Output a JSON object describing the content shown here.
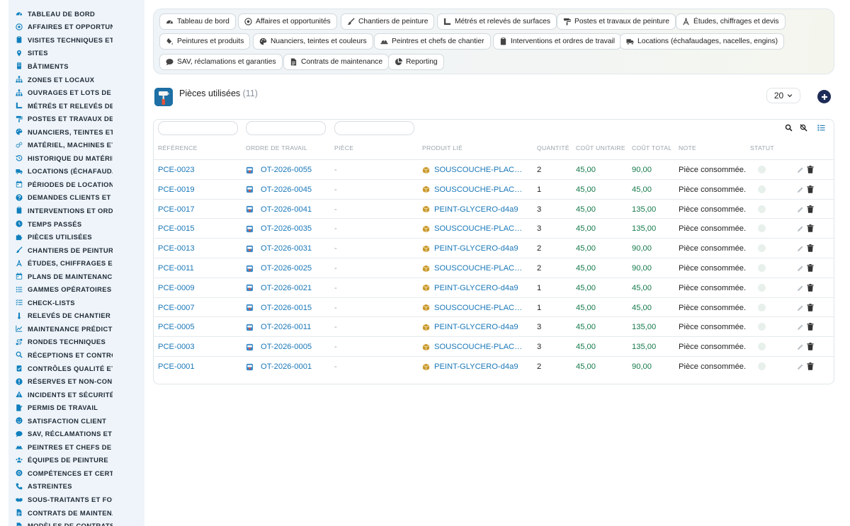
{
  "sidebar": {
    "items": [
      {
        "label": "TABLEAU DE BORD",
        "icon": "dashboard-icon"
      },
      {
        "label": "AFFAIRES ET OPPORTUNITÉS",
        "icon": "target-icon"
      },
      {
        "label": "VISITES TECHNIQUES ET DIAGNOSTICS",
        "icon": "clipboard-icon"
      },
      {
        "label": "SITES",
        "icon": "map-pin-icon"
      },
      {
        "label": "BÂTIMENTS",
        "icon": "building-icon"
      },
      {
        "label": "ZONES ET LOCAUX",
        "icon": "hierarchy-icon"
      },
      {
        "label": "OUVRAGES ET LOTS DE TRAVAUX",
        "icon": "hierarchy-icon"
      },
      {
        "label": "MÉTRÉS ET RELEVÉS DE SURFACES",
        "icon": "ruler-icon"
      },
      {
        "label": "POSTES ET TRAVAUX DE PEINTURE",
        "icon": "paint-roller-icon"
      },
      {
        "label": "NUANCIERS, TEINTES ET COULEURS",
        "icon": "palette-icon"
      },
      {
        "label": "MATÉRIEL, MACHINES ET OUTILLAGE",
        "icon": "gears-icon"
      },
      {
        "label": "HISTORIQUE DU MATÉRIEL",
        "icon": "history-icon"
      },
      {
        "label": "LOCATIONS (ÉCHAFAUDAGES, NACELLES)",
        "icon": "truck-icon"
      },
      {
        "label": "PÉRIODES DE LOCATION",
        "icon": "calendar-icon"
      },
      {
        "label": "DEMANDES CLIENTS ET INTERVENTIONS",
        "icon": "question-icon"
      },
      {
        "label": "INTERVENTIONS ET ORDRES DE TRAVAIL",
        "icon": "clipboard-icon"
      },
      {
        "label": "TEMPS PASSÉS",
        "icon": "clock-icon"
      },
      {
        "label": "PIÈCES UTILISÉES",
        "icon": "puzzle-icon"
      },
      {
        "label": "CHANTIERS DE PEINTURE",
        "icon": "brush-icon"
      },
      {
        "label": "ÉTUDES, CHIFFRAGES ET DEVIS",
        "icon": "compass-icon"
      },
      {
        "label": "PLANS DE MAINTENANCE",
        "icon": "calendar-icon"
      },
      {
        "label": "GAMMES OPÉRATOIRES",
        "icon": "list-icon"
      },
      {
        "label": "CHECK-LISTS",
        "icon": "checklist-icon"
      },
      {
        "label": "RELEVÉS DE CHANTIER",
        "icon": "thermometer-icon"
      },
      {
        "label": "MAINTENANCE PRÉDICTIVE",
        "icon": "chart-icon"
      },
      {
        "label": "RONDES TECHNIQUES",
        "icon": "route-icon"
      },
      {
        "label": "RÉCEPTIONS ET CONTRÔLES",
        "icon": "search-icon"
      },
      {
        "label": "CONTRÔLES QUALITÉ ET AUDITS",
        "icon": "clipboard-check-icon"
      },
      {
        "label": "RÉSERVES ET NON-CONFORMITÉS",
        "icon": "alert-circle-icon"
      },
      {
        "label": "INCIDENTS ET SÉCURITÉ",
        "icon": "warning-icon"
      },
      {
        "label": "PERMIS DE TRAVAIL",
        "icon": "file-signature-icon"
      },
      {
        "label": "SATISFACTION CLIENT",
        "icon": "smile-icon"
      },
      {
        "label": "SAV, RÉCLAMATIONS ET GARANTIES",
        "icon": "comment-icon"
      },
      {
        "label": "PEINTRES ET CHEFS DE CHANTIER",
        "icon": "hard-hat-icon"
      },
      {
        "label": "ÉQUIPES DE PEINTURE",
        "icon": "users-icon"
      },
      {
        "label": "COMPÉTENCES ET CERTIFICATIONS",
        "icon": "badge-icon"
      },
      {
        "label": "ASTREINTES",
        "icon": "phone-icon"
      },
      {
        "label": "SOUS-TRAITANTS ET FOURNISSEURS",
        "icon": "handshake-icon"
      },
      {
        "label": "CONTRATS DE MAINTENANCE",
        "icon": "file-icon"
      },
      {
        "label": "MODÈLES DE CONTRATS",
        "icon": "file-icon"
      }
    ]
  },
  "nav": {
    "chips": [
      {
        "label": "Tableau de bord",
        "icon": "dashboard-icon"
      },
      {
        "label": "Affaires et opportunités",
        "icon": "target-icon"
      },
      {
        "label": "Chantiers de peinture",
        "icon": "brush-icon"
      },
      {
        "label": "Métrés et relevés de surfaces",
        "icon": "ruler-icon"
      },
      {
        "label": "Postes et travaux de peinture",
        "icon": "paint-roller-icon"
      },
      {
        "label": "Études, chiffrages et devis",
        "icon": "compass-icon"
      },
      {
        "label": "Peintures et produits",
        "icon": "fill-drip-icon"
      },
      {
        "label": "Nuanciers, teintes et couleurs",
        "icon": "palette-icon"
      },
      {
        "label": "Peintres et chefs de chantier",
        "icon": "hard-hat-icon"
      },
      {
        "label": "Interventions et ordres de travail",
        "icon": "clipboard-icon"
      },
      {
        "label": "Locations (échafaudages, nacelles, engins)",
        "icon": "truck-icon"
      },
      {
        "label": "SAV, réclamations et garanties",
        "icon": "comment-icon"
      },
      {
        "label": "Contrats de maintenance",
        "icon": "file-icon"
      },
      {
        "label": "Reporting",
        "icon": "chart-pie-icon"
      }
    ]
  },
  "header": {
    "title": "Pièces utilisées",
    "count": "(11)",
    "page_size": "20"
  },
  "table": {
    "columns": [
      "RÉFÉRENCE",
      "ORDRE DE TRAVAIL",
      "PIÈCE",
      "PRODUIT LIÉ",
      "QUANTITÉ",
      "COÛT UNITAIRE",
      "COÛT TOTAL",
      "NOTE",
      "STATUT"
    ],
    "rows": [
      {
        "ref": "PCE-0023",
        "ordre": "OT-2026-0055",
        "piece": "-",
        "produit": "SOUSCOUCHE-PLACO-…",
        "qty": "2",
        "cu": "45,00",
        "ct": "90,00",
        "note": "Pièce consommée."
      },
      {
        "ref": "PCE-0019",
        "ordre": "OT-2026-0045",
        "piece": "-",
        "produit": "SOUSCOUCHE-PLACO-…",
        "qty": "1",
        "cu": "45,00",
        "ct": "45,00",
        "note": "Pièce consommée."
      },
      {
        "ref": "PCE-0017",
        "ordre": "OT-2026-0041",
        "piece": "-",
        "produit": "PEINT-GLYCERO-d4a9",
        "qty": "3",
        "cu": "45,00",
        "ct": "135,00",
        "note": "Pièce consommée."
      },
      {
        "ref": "PCE-0015",
        "ordre": "OT-2026-0035",
        "piece": "-",
        "produit": "SOUSCOUCHE-PLACO-…",
        "qty": "3",
        "cu": "45,00",
        "ct": "135,00",
        "note": "Pièce consommée."
      },
      {
        "ref": "PCE-0013",
        "ordre": "OT-2026-0031",
        "piece": "-",
        "produit": "PEINT-GLYCERO-d4a9",
        "qty": "2",
        "cu": "45,00",
        "ct": "90,00",
        "note": "Pièce consommée."
      },
      {
        "ref": "PCE-0011",
        "ordre": "OT-2026-0025",
        "piece": "-",
        "produit": "SOUSCOUCHE-PLACO-…",
        "qty": "2",
        "cu": "45,00",
        "ct": "90,00",
        "note": "Pièce consommée."
      },
      {
        "ref": "PCE-0009",
        "ordre": "OT-2026-0021",
        "piece": "-",
        "produit": "PEINT-GLYCERO-d4a9",
        "qty": "1",
        "cu": "45,00",
        "ct": "45,00",
        "note": "Pièce consommée."
      },
      {
        "ref": "PCE-0007",
        "ordre": "OT-2026-0015",
        "piece": "-",
        "produit": "SOUSCOUCHE-PLACO-…",
        "qty": "1",
        "cu": "45,00",
        "ct": "45,00",
        "note": "Pièce consommée."
      },
      {
        "ref": "PCE-0005",
        "ordre": "OT-2026-0011",
        "piece": "-",
        "produit": "PEINT-GLYCERO-d4a9",
        "qty": "3",
        "cu": "45,00",
        "ct": "135,00",
        "note": "Pièce consommée."
      },
      {
        "ref": "PCE-0003",
        "ordre": "OT-2026-0005",
        "piece": "-",
        "produit": "SOUSCOUCHE-PLACO-…",
        "qty": "3",
        "cu": "45,00",
        "ct": "135,00",
        "note": "Pièce consommée."
      },
      {
        "ref": "PCE-0001",
        "ordre": "OT-2026-0001",
        "piece": "-",
        "produit": "PEINT-GLYCERO-d4a9",
        "qty": "2",
        "cu": "45,00",
        "ct": "90,00",
        "note": "Pièce consommée."
      }
    ]
  },
  "colors": {
    "accent": "#1b78b8",
    "money": "#167a4b",
    "sidebar_bg": "#eef4f9",
    "add_button": "#1d2b57"
  }
}
